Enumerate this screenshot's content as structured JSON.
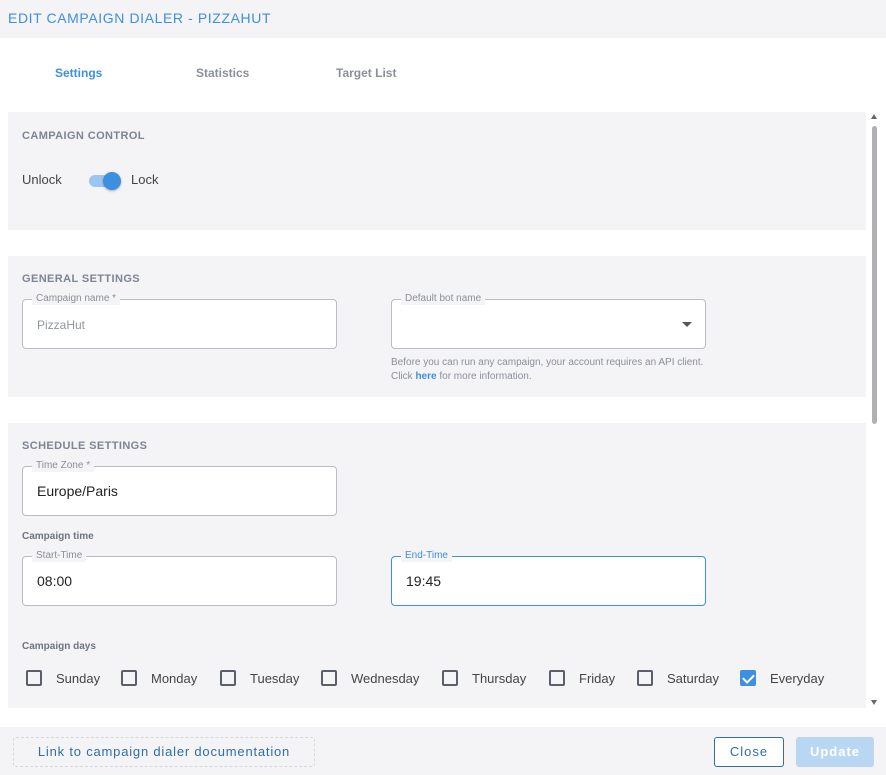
{
  "dialog": {
    "title": "EDIT CAMPAIGN DIALER - PIZZAHUT"
  },
  "tabs": [
    {
      "label": "Settings",
      "active": true
    },
    {
      "label": "Statistics",
      "active": false
    },
    {
      "label": "Target List",
      "active": false
    }
  ],
  "campaign_control": {
    "title": "CAMPAIGN CONTROL",
    "unlock_label": "Unlock",
    "lock_label": "Lock",
    "locked": true
  },
  "general_settings": {
    "title": "GENERAL SETTINGS",
    "campaign_name": {
      "label": "Campaign name *",
      "value": "PizzaHut"
    },
    "default_bot": {
      "label": "Default bot name",
      "value": ""
    },
    "help_text_1": "Before you can run any campaign, your account requires an API client. Click",
    "help_link": "here",
    "help_text_2": "for more information."
  },
  "schedule_settings": {
    "title": "SCHEDULE SETTINGS",
    "time_zone": {
      "label": "Time Zone *",
      "value": "Europe/Paris"
    },
    "campaign_time_label": "Campaign time",
    "start_time": {
      "label": "Start-Time",
      "value": "08:00"
    },
    "end_time": {
      "label": "End-Time",
      "value": "19:45"
    },
    "campaign_days_label": "Campaign days",
    "days": [
      {
        "label": "Sunday",
        "checked": false
      },
      {
        "label": "Monday",
        "checked": false
      },
      {
        "label": "Tuesday",
        "checked": false
      },
      {
        "label": "Wednesday",
        "checked": false
      },
      {
        "label": "Thursday",
        "checked": false
      },
      {
        "label": "Friday",
        "checked": false
      },
      {
        "label": "Saturday",
        "checked": false
      },
      {
        "label": "Everyday",
        "checked": true
      }
    ]
  },
  "footer": {
    "doc_link": "Link to campaign dialer documentation",
    "close_label": "Close",
    "update_label": "Update"
  },
  "colors": {
    "accent": "#3d8fe0",
    "section_bg": "#f4f4f6"
  }
}
